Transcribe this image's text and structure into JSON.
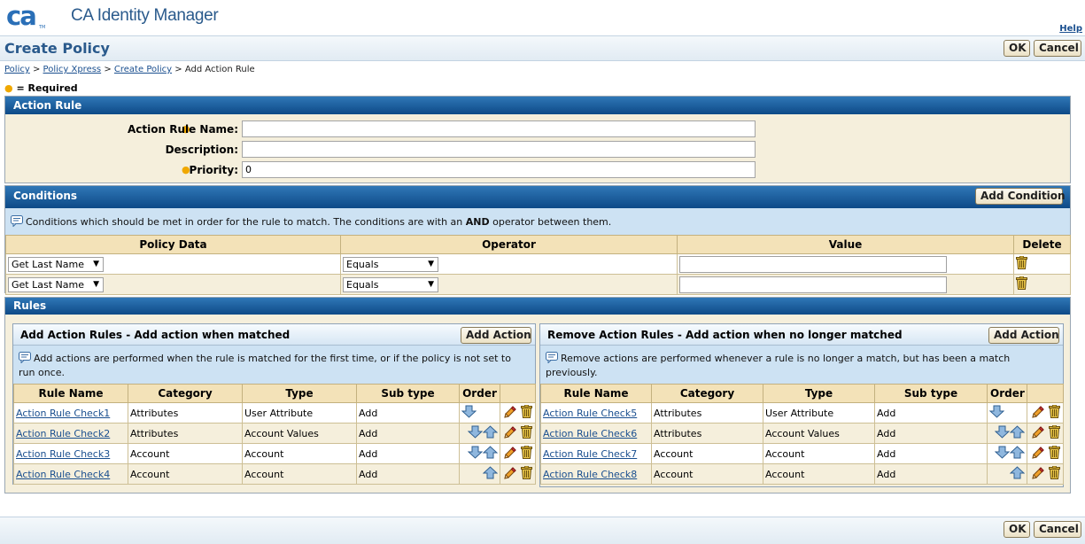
{
  "app": {
    "logo_text": "ca",
    "logo_tm": "TM",
    "title": "CA Identity Manager",
    "help": "Help"
  },
  "page": {
    "title": "Create Policy",
    "ok": "OK",
    "cancel": "Cancel"
  },
  "breadcrumb": {
    "items": [
      "Policy",
      "Policy Xpress",
      "Create Policy"
    ],
    "sep": ">",
    "current": "Add Action Rule"
  },
  "required_note": "= Required",
  "action_rule": {
    "heading": "Action Rule",
    "name_label": "Action Rule Name:",
    "name_value": "",
    "description_label": "Description:",
    "description_value": "",
    "priority_label": "Priority:",
    "priority_value": "0"
  },
  "conditions": {
    "heading": "Conditions",
    "add_button": "Add Condition",
    "info_pre": "Conditions which should be met in order for the rule to match. The conditions are with an ",
    "info_bold": "AND",
    "info_post": " operator between them.",
    "columns": [
      "Policy Data",
      "Operator",
      "Value",
      "Delete"
    ],
    "rows": [
      {
        "policy_data": "Get Last Name",
        "operator": "Equals",
        "value": ""
      },
      {
        "policy_data": "Get Last Name",
        "operator": "Equals",
        "value": ""
      }
    ]
  },
  "rules": {
    "heading": "Rules",
    "add_panel": {
      "title": "Add Action Rules - Add action when matched",
      "add_button": "Add Action",
      "info": "Add actions are performed when the rule is matched for the first time, or if the policy is not set to run once.",
      "columns": [
        "Rule Name",
        "Category",
        "Type",
        "Sub type",
        "Order",
        ""
      ],
      "rows": [
        {
          "name": "Action Rule Check1",
          "category": "Attributes",
          "type": "User Attribute",
          "subtype": "Add"
        },
        {
          "name": "Action Rule Check2",
          "category": "Attributes",
          "type": "Account Values",
          "subtype": "Add"
        },
        {
          "name": "Action Rule Check3",
          "category": "Account",
          "type": "Account",
          "subtype": "Add"
        },
        {
          "name": "Action Rule Check4",
          "category": "Account",
          "type": "Account",
          "subtype": "Add"
        }
      ]
    },
    "remove_panel": {
      "title": "Remove Action Rules - Add action when no longer matched",
      "add_button": "Add Action",
      "info": "Remove actions are performed whenever a rule is no longer a match, but has been a match previously.",
      "columns": [
        "Rule Name",
        "Category",
        "Type",
        "Sub type",
        "Order",
        ""
      ],
      "rows": [
        {
          "name": "Action Rule Check5",
          "category": "Attributes",
          "type": "User Attribute",
          "subtype": "Add"
        },
        {
          "name": "Action Rule Check6",
          "category": "Attributes",
          "type": "Account Values",
          "subtype": "Add"
        },
        {
          "name": "Action Rule Check7",
          "category": "Account",
          "type": "Account",
          "subtype": "Add"
        },
        {
          "name": "Action Rule Check8",
          "category": "Account",
          "type": "Account",
          "subtype": "Add"
        }
      ]
    }
  },
  "footer": {
    "ok": "OK",
    "cancel": "Cancel"
  },
  "colors": {
    "brand": "#2a5a8c",
    "section_header": "#0e4a87",
    "panel_bg": "#f5efdc",
    "info_bg": "#cde2f3",
    "required_dot": "#f0a800"
  },
  "icons": [
    "ca-logo",
    "info-icon",
    "trash-icon",
    "edit-pencil-icon",
    "arrow-down-icon",
    "arrow-up-icon",
    "dropdown-arrow-icon",
    "required-dot-icon"
  ]
}
